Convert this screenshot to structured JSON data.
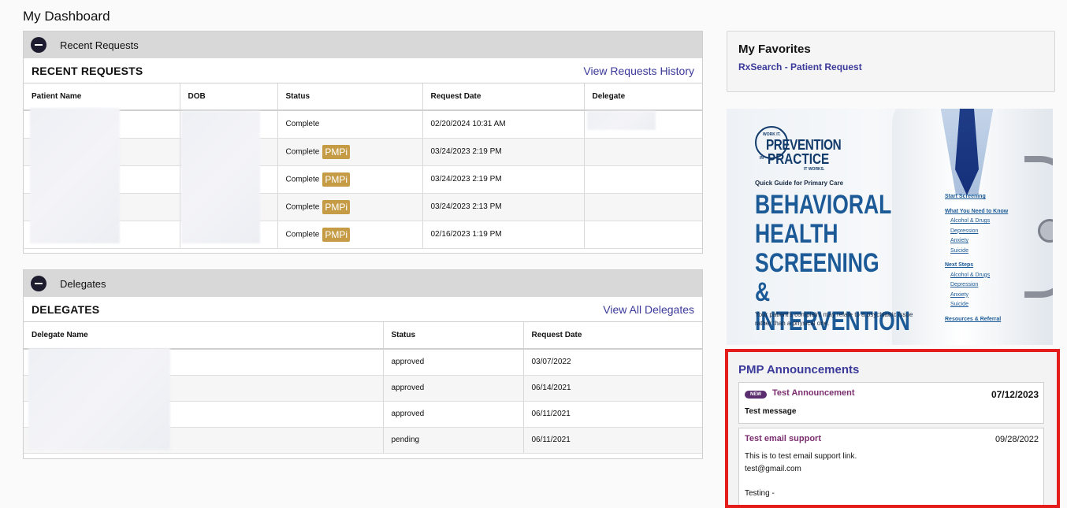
{
  "page": {
    "title": "My Dashboard"
  },
  "recent_requests": {
    "header_label": "Recent Requests",
    "title": "RECENT REQUESTS",
    "history_link": "View Requests History",
    "columns": [
      "Patient Name",
      "DOB",
      "Status",
      "Request Date",
      "Delegate"
    ],
    "rows": [
      {
        "status": "Complete",
        "badge": "",
        "date": "02/20/2024 10:31 AM"
      },
      {
        "status": "Complete",
        "badge": "PMPi",
        "date": "03/24/2023 2:19 PM"
      },
      {
        "status": "Complete",
        "badge": "PMPi",
        "date": "03/24/2023 2:19 PM"
      },
      {
        "status": "Complete",
        "badge": "PMPi",
        "date": "03/24/2023 2:13 PM"
      },
      {
        "status": "Complete",
        "badge": "PMPi",
        "date": "02/16/2023 1:19 PM"
      }
    ]
  },
  "delegates": {
    "header_label": "Delegates",
    "title": "DELEGATES",
    "view_link": "View All Delegates",
    "columns": [
      "Delegate Name",
      "Status",
      "Request Date"
    ],
    "rows": [
      {
        "status": "approved",
        "date": "03/07/2022"
      },
      {
        "status": "approved",
        "date": "06/14/2021"
      },
      {
        "status": "approved",
        "date": "06/11/2021"
      },
      {
        "status": "pending",
        "date": "06/11/2021"
      }
    ]
  },
  "favorites": {
    "title": "My Favorites",
    "link": "RxSearch - Patient Request"
  },
  "banner": {
    "logo_top": "WORK IT.",
    "logo_prevention": "PREVENTION",
    "logo_in": "IN",
    "logo_practice": "PRACTICE",
    "logo_bottom": "IT WORKS.",
    "guide": "Quick Guide for Primary Care",
    "headline_1": "BEHAVIORAL",
    "headline_2": "HEALTH",
    "headline_3": "SCREENING",
    "headline_4": "& INTERVENTION",
    "caption": "Your patient's complaint may relate to a psychiatric issue rather than a physical one.",
    "start_screening": "Start Screening",
    "what_to_know": "What You Need to Know",
    "know_items": [
      "Alcohol & Drugs",
      "Depression",
      "Anxiety",
      "Suicide"
    ],
    "next_steps": "Next Steps",
    "next_items": [
      "Alcohol & Drugs",
      "Depression",
      "Anxiety",
      "Suicide"
    ],
    "resources": "Resources & Referral"
  },
  "announcements": {
    "title": "PMP Announcements",
    "items": [
      {
        "badge": "NEW",
        "name": "Test Announcement",
        "date": "07/12/2023",
        "message": "Test message"
      },
      {
        "name": "Test email support",
        "date": "09/28/2022",
        "line1": "This is to test email support link.",
        "line2": "test@gmail.com",
        "line3": "Testing -"
      }
    ]
  },
  "colors": {
    "accent": "#3b3a9a",
    "pmpi_badge": "#c59b45",
    "highlight_border": "#e41c1c"
  }
}
